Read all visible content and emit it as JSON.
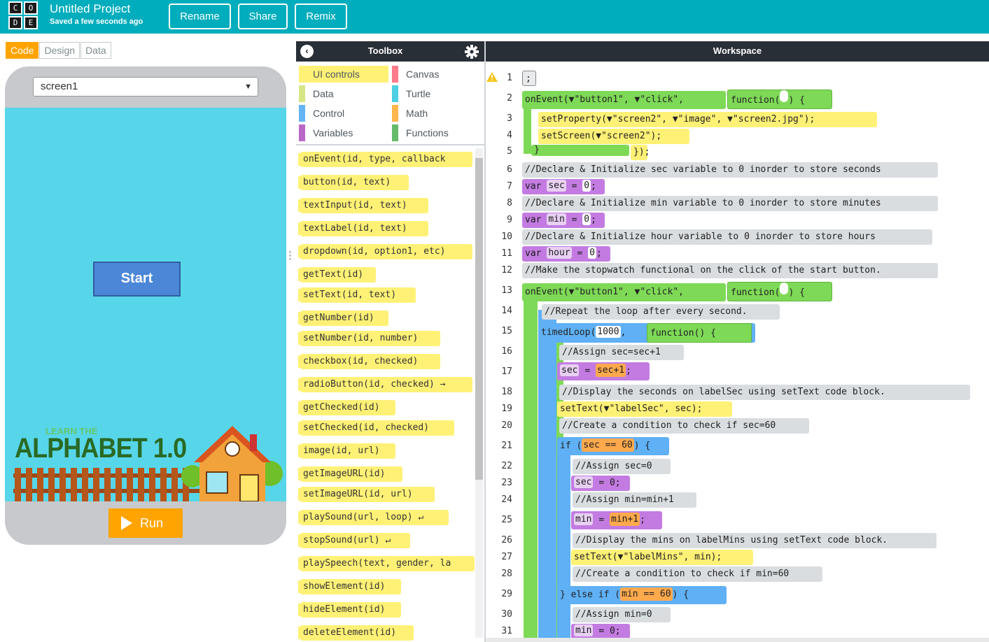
{
  "header": {
    "logo_letters": [
      "C",
      "O",
      "D",
      "E"
    ],
    "project_title": "Untitled Project",
    "project_status": "Saved a few seconds ago",
    "buttons": {
      "rename": "Rename",
      "share": "Share",
      "remix": "Remix"
    },
    "brand_color": "#00adbc"
  },
  "left_panel": {
    "mode_tabs": [
      "Code",
      "Design",
      "Data"
    ],
    "active_tab": "Code",
    "screen_select": "screen1",
    "app": {
      "start_button": "Start",
      "banner_small": "LEARN THE",
      "banner_title": "ALPHABET 1.0"
    },
    "run_button": "Run"
  },
  "toolbox": {
    "title": "Toolbox",
    "categories": [
      {
        "name": "UI controls",
        "color": "#fff176"
      },
      {
        "name": "Canvas",
        "color": "#ff7a8a"
      },
      {
        "name": "Data",
        "color": "#d6e685"
      },
      {
        "name": "Turtle",
        "color": "#4dd0e1"
      },
      {
        "name": "Control",
        "color": "#64b5f6"
      },
      {
        "name": "Math",
        "color": "#ffb74d"
      },
      {
        "name": "Variables",
        "color": "#ba68c8"
      },
      {
        "name": "Functions",
        "color": "#66bb6a"
      }
    ],
    "active_category": "UI controls",
    "blocks": [
      "onEvent(id, type, callback",
      "button(id, text)",
      "textInput(id, text)",
      "textLabel(id, text)",
      "dropdown(id, option1, etc)",
      "getText(id)",
      "setText(id, text)",
      "getNumber(id)",
      "setNumber(id, number)",
      "checkbox(id, checked)",
      "radioButton(id, checked) →",
      "getChecked(id)",
      "setChecked(id, checked)",
      "image(id, url)",
      "getImageURL(id)",
      "setImageURL(id, url)",
      "playSound(url, loop) ↵",
      "stopSound(url) ↵",
      "playSpeech(text, gender, la",
      "showElement(id)",
      "hideElement(id)",
      "deleteElement(id)"
    ]
  },
  "workspace": {
    "title": "Workspace",
    "line_numbers": [
      "1",
      "2",
      "3",
      "4",
      "5",
      "6",
      "7",
      "8",
      "9",
      "10",
      "11",
      "12",
      "13",
      "14",
      "15",
      "16",
      "17",
      "18",
      "19",
      "20",
      "21",
      "22",
      "23",
      "24",
      "25",
      "26",
      "27",
      "28",
      "29",
      "30",
      "31"
    ],
    "lines": {
      "l1": ";",
      "l2_onEvent": "onEvent(▼\"button1\", ▼\"click\",",
      "l2_fn": "function(",
      "l2_end": ") {",
      "l3": "setProperty(▼\"screen2\", ▼\"image\", ▼\"screen2.jpg\");",
      "l4": "setScreen(▼\"screen2\");",
      "l5_end": "});",
      "l5_brace": "}",
      "l6": "//Declare & Initialize sec variable to 0 inorder to store seconds",
      "l7_var": "var",
      "l7_name": "sec",
      "l7_eq": "=",
      "l7_val": "0",
      "l8": "//Declare & Initialize min variable to 0 inorder to store minutes",
      "l9_var": "var",
      "l9_name": "min",
      "l9_eq": "=",
      "l9_val": "0",
      "l10": "//Declare & Initialize hour variable to 0 inorder to store hours",
      "l11_var": "var",
      "l11_name": "hour",
      "l11_eq": "=",
      "l11_val": "0",
      "l12": "//Make the stopwatch functional on the click of the start button.",
      "l13_onEvent": "onEvent(▼\"button1\", ▼\"click\",",
      "l13_fn": "function(",
      "l13_end": ") {",
      "l14": "//Repeat the loop after every second.",
      "l15_loop": "timedLoop(",
      "l15_ms": "1000",
      "l15_comma": ",",
      "l15_fn": "function() {",
      "l16": "//Assign sec=sec+1",
      "l17_name": "sec",
      "l17_eq": "=",
      "l17_expr": "sec+1",
      "l18": "//Display the seconds on labelSec using setText code block.",
      "l19": "setText(▼\"labelSec\", sec);",
      "l20": "//Create a condition to check if sec=60",
      "l21_if": "if (",
      "l21_cond": "sec == 60",
      "l21_end": ") {",
      "l22": "//Assign sec=0",
      "l23_name": "sec",
      "l23_rest": "= 0;",
      "l24": "//Assign min=min+1",
      "l25_name": "min",
      "l25_eq": "=",
      "l25_expr": "min+1",
      "l26": "//Display the mins on labelMins using setText code block.",
      "l27": "setText(▼\"labelMins\", min);",
      "l28": "//Create a condition to check if min=60",
      "l29_else": "} else if (",
      "l29_cond": "min == 60",
      "l29_end": ") {",
      "l30": "//Assign min=0",
      "l31_name": "min",
      "l31_rest": "= 0;"
    }
  }
}
